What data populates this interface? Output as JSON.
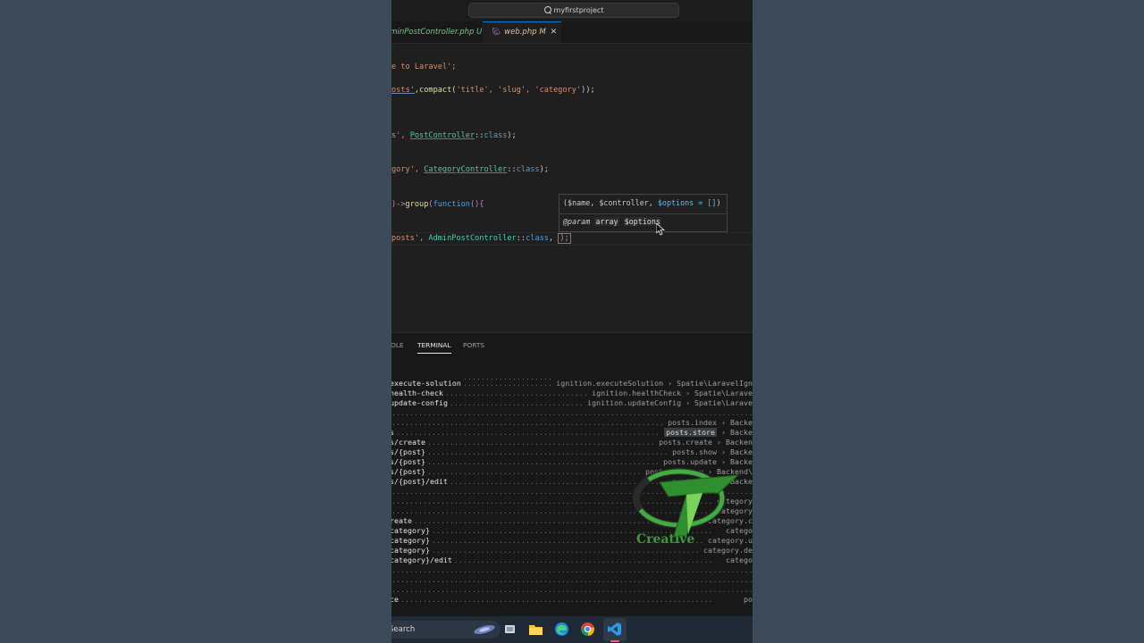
{
  "command_center": {
    "text": "myfirstproject"
  },
  "tabs": [
    {
      "label": "AdminPostController.php",
      "status": "U"
    },
    {
      "label": "web.php",
      "status": "M"
    }
  ],
  "code_lines": {
    "l1": "e to Laravel';",
    "l2a": "osts'",
    "l2b": ",compact(",
    "l2c": "'title', 'slug', 'category'",
    "l2d": "));",
    "l3a": "s', ",
    "l3b": "PostController",
    "l3c": "::",
    "l3d": "class",
    "l3e": ");",
    "l4a": "gory', ",
    "l4b": "CategoryController",
    "l4c": "::",
    "l4d": "class",
    "l4e": ");",
    "l5a": ")->",
    "l5b": "group",
    "l5c": "(",
    "l5d": "function",
    "l5e": "(){",
    "l6a": "posts', ",
    "l6b": "AdminPostController",
    "l6c": "::",
    "l6d": "class",
    "l6e": ", ",
    "l6f": ");"
  },
  "hover": {
    "signature_a": "($name, $controller, ",
    "signature_b": "$options = []",
    "signature_c": ")",
    "doc_tag": "@param",
    "doc_type": "array",
    "doc_var": "$options"
  },
  "panel_tabs": [
    {
      "label": "OLE",
      "active": false
    },
    {
      "label": "TERMINAL",
      "active": true
    },
    {
      "label": "PORTS",
      "active": false
    }
  ],
  "routes": [
    {
      "uri": "",
      "name": ""
    },
    {
      "uri": "execute-solution",
      "name": "ignition.executeSolution › Spatie\\LaravelIgn"
    },
    {
      "uri": "health-check",
      "name": "ignition.healthCheck › Spatie\\Larave"
    },
    {
      "uri": "update-config",
      "name": "ignition.updateConfig › Spatie\\Larave"
    },
    {
      "uri": "",
      "name": ""
    },
    {
      "uri": "",
      "name": "posts.index › Backe"
    },
    {
      "uri": "s",
      "name": "posts.store",
      "name_suffix": " › Backe"
    },
    {
      "uri": "s/create",
      "name": "posts.create › Backen"
    },
    {
      "uri": "s/{post}",
      "name": "posts.show › Backe"
    },
    {
      "uri": "s/{post}",
      "name": "posts.update › Backe"
    },
    {
      "uri": "s/{post}",
      "name": "posts.destroy › Backend\\"
    },
    {
      "uri": "s/{post}/edit",
      "name": "posts.edit › Backe"
    },
    {
      "uri": "",
      "name": ""
    },
    {
      "uri": "",
      "name": "category"
    },
    {
      "uri": "",
      "name": "category"
    },
    {
      "uri": "reate",
      "name": "category.c"
    },
    {
      "uri": "category}",
      "name": "catego"
    },
    {
      "uri": "category}",
      "name": "category.u"
    },
    {
      "uri": "category}",
      "name": "category.de"
    },
    {
      "uri": "category}/edit",
      "name": "catego"
    },
    {
      "uri": "",
      "name": ""
    },
    {
      "uri": "",
      "name": ""
    },
    {
      "uri": "",
      "name": ""
    },
    {
      "uri": "ce",
      "name": "po"
    }
  ],
  "taskbar": {
    "search_label": "Search"
  },
  "watermark": {
    "text": "Creative"
  },
  "colors": {
    "accent": "#0078d4",
    "editor_bg": "#1f1f1f",
    "page_bg": "#3d4a5a"
  }
}
